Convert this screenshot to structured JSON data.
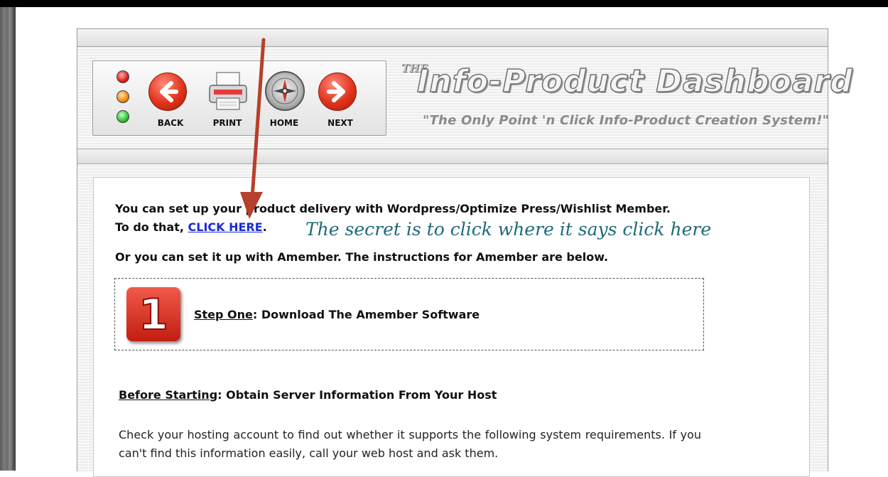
{
  "nav": {
    "back": "BACK",
    "print": "PRINT",
    "home": "HOME",
    "next": "NEXT"
  },
  "logo": {
    "the": "THE",
    "title": "Info-Product Dashboard",
    "tagline": "\"The Only Point 'n Click Info-Product Creation System!\""
  },
  "content": {
    "line1": "You can set up your product delivery with Wordpress/Optimize Press/Wishlist Member.",
    "line2_prefix": "To do that, ",
    "click_here": "CLICK HERE",
    "line2_suffix": ".",
    "annotation": "The secret is to click where it says click here",
    "line3": "Or you can set it up with Amember. The instructions for Amember are below.",
    "step_number": "1",
    "step_label": "Step One",
    "step_text": ": Download The Amember Software",
    "before_label": "Before Starting",
    "before_text": ": Obtain Server Information From Your Host",
    "body": "Check your hosting account to find out whether it supports the following system requirements. If you can't find this information easily, call your web host and ask them."
  },
  "colors": {
    "link": "#1a2bd4",
    "annotation": "#1e6a78",
    "arrow": "#b5402c"
  }
}
